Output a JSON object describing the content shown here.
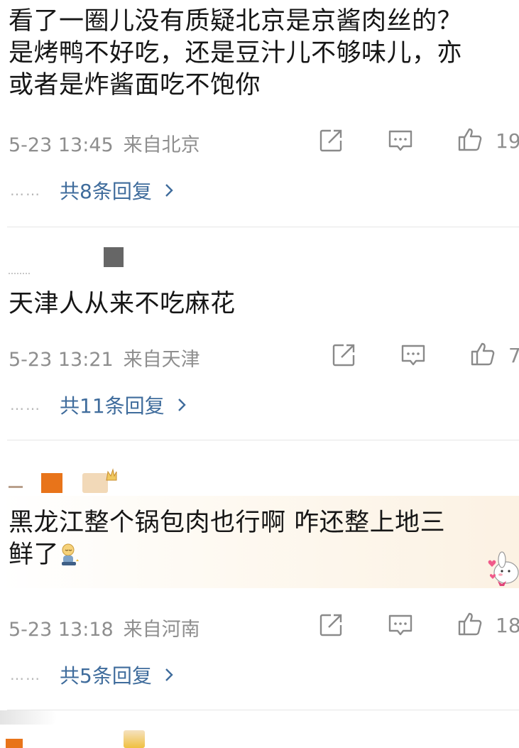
{
  "comments": [
    {
      "text": "看了一圈儿没有质疑北京是京酱肉丝的？\n是烤鸭不好吃，还是豆汁儿不够味儿，亦\n或者是炸酱面吃不饱你",
      "time": "5-23 13:45",
      "location": "来自北京",
      "likes": "19",
      "replies": "共8条回复"
    },
    {
      "text": "天津人从来不吃麻花",
      "time": "5-23 13:21",
      "location": "来自天津",
      "likes": "7",
      "replies": "共11条回复"
    },
    {
      "text": "黑龙江整个锅包肉也行啊 咋还整上地三\n鲜了",
      "time": "5-23 13:18",
      "location": "来自河南",
      "likes": "18",
      "replies": "共5条回复"
    }
  ],
  "reply_dots": "……",
  "icons": [
    "repost-icon",
    "comment-icon",
    "thumbs-up-icon",
    "chevron-right-icon"
  ],
  "colors": {
    "reply_link": "#3f6c9c",
    "meta_text": "#8e8e8e",
    "icon_stroke": "#8a8a8a",
    "badge_orange": "#e8741a",
    "badge_gray": "#666666"
  }
}
